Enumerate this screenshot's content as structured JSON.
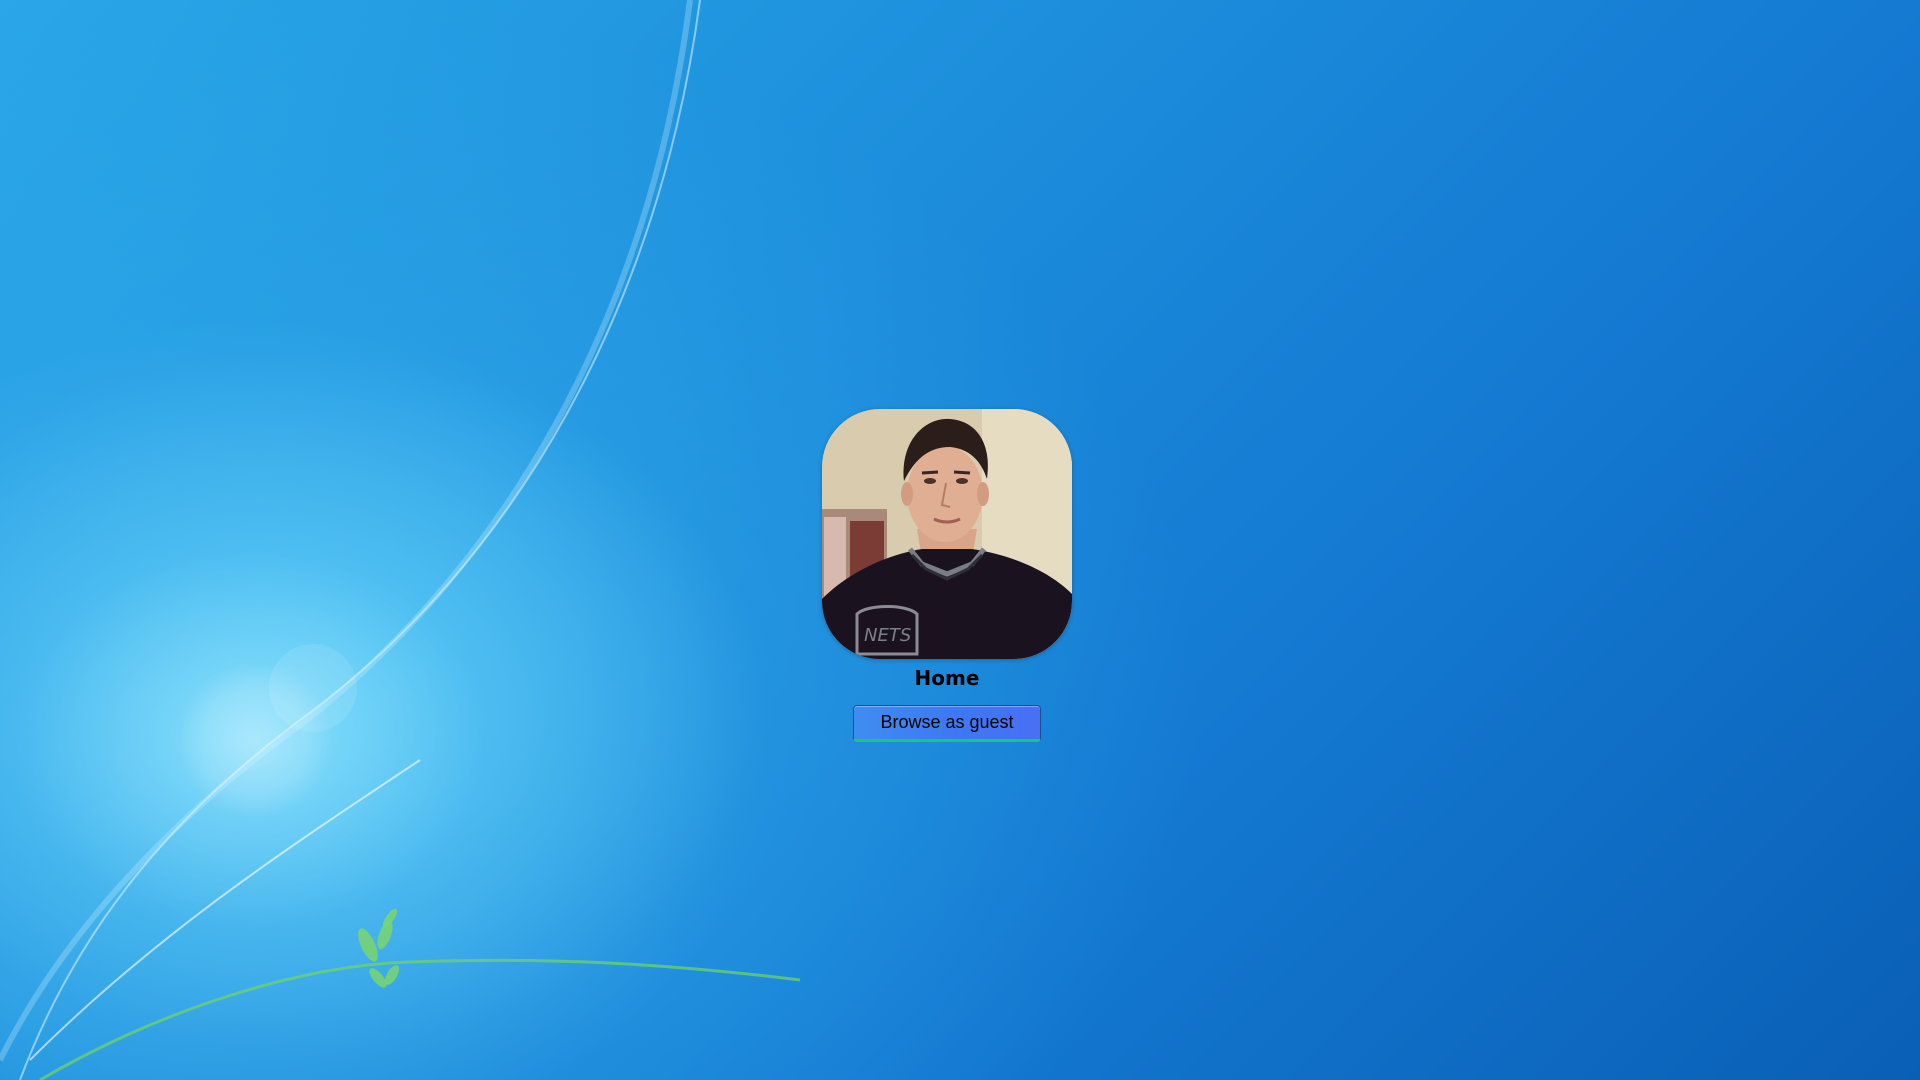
{
  "user": {
    "name": "Home"
  },
  "actions": {
    "guest_label": "Browse as guest"
  },
  "icons": {
    "avatar": "user-profile-photo"
  },
  "colors": {
    "button_start": "#3f8df0",
    "button_end": "#4a6ff4",
    "button_accent": "#19c77a",
    "wallpaper_dark": "#0a5fb5",
    "wallpaper_light": "#2aa7e8"
  }
}
